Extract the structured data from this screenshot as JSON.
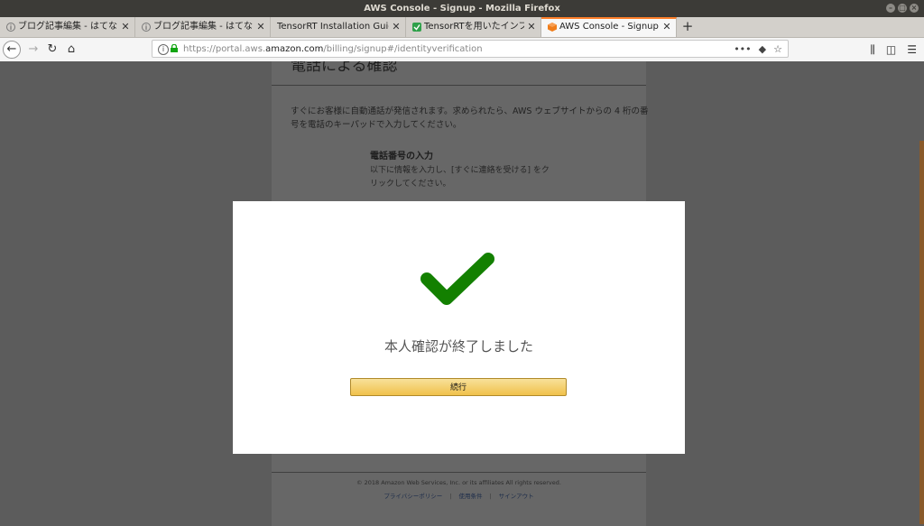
{
  "window": {
    "title": "AWS Console - Signup - Mozilla Firefox"
  },
  "tabs": [
    {
      "label": "ブログ記事編集 - はてな",
      "icon": "hatena-icon"
    },
    {
      "label": "ブログ記事編集 - はてな",
      "icon": "hatena-icon"
    },
    {
      "label": "TensorRT Installation Guide",
      "icon": ""
    },
    {
      "label": "TensorRTを用いたインフ",
      "icon": "green-square-icon"
    },
    {
      "label": "AWS Console - Signup",
      "icon": "aws-cube-icon",
      "active": true
    }
  ],
  "url": {
    "prefix": "https://portal.aws.",
    "domain": "amazon.com",
    "suffix": "/billing/signup#/identityverification"
  },
  "page": {
    "heading": "電話による確認",
    "intro": "すぐにお客様に自動通話が発信されます。求められたら、AWS ウェブサイトからの 4 桁の番号を電話のキーパッドで入力してください。",
    "phone_heading": "電話番号の入力",
    "phone_text": "以下に情報を入力し、[すぐに連絡を受ける] をクリックしてください。",
    "copyright": "© 2018 Amazon Web Services, Inc. or its affiliates All rights reserved.",
    "footer_links": [
      "プライバシーポリシー",
      "使用条件",
      "サインアウト"
    ]
  },
  "modal": {
    "title": "本人確認が終了しました",
    "button": "続行",
    "check_color": "#138000"
  },
  "colors": {
    "active_tab_accent": "#ff7f2a",
    "button_bg": "#f0c14b"
  }
}
